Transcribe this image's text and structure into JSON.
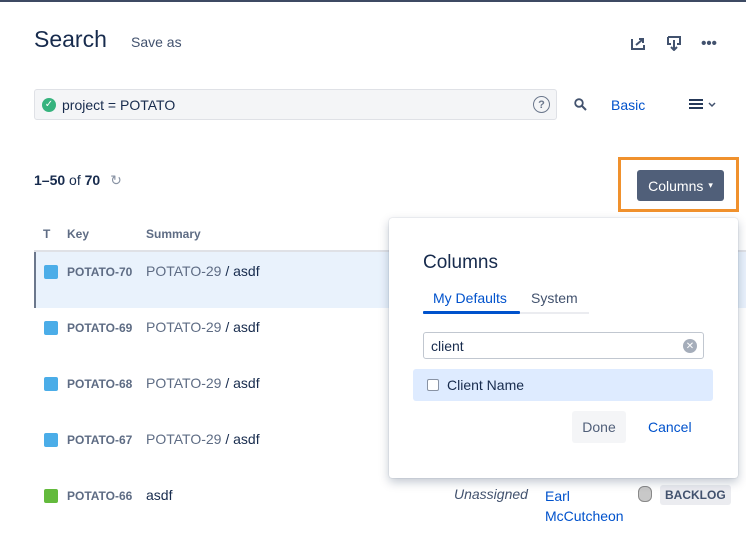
{
  "header": {
    "title": "Search",
    "save_as": "Save as"
  },
  "toolbar_icons": [
    "share-icon",
    "export-icon",
    "more-icon"
  ],
  "jql": {
    "query": "project = POTATO",
    "help": "?",
    "basic_label": "Basic"
  },
  "results": {
    "range": "1–50",
    "of": "of",
    "total": "70"
  },
  "columns_button": "Columns",
  "table": {
    "headers": [
      "T",
      "Key",
      "Summary"
    ],
    "rows": [
      {
        "type": "subtask",
        "key": "POTATO-70",
        "parent": "POTATO-29",
        "summary": "asdf"
      },
      {
        "type": "subtask",
        "key": "POTATO-69",
        "parent": "POTATO-29",
        "summary": "asdf"
      },
      {
        "type": "subtask",
        "key": "POTATO-68",
        "parent": "POTATO-29",
        "summary": "asdf"
      },
      {
        "type": "subtask",
        "key": "POTATO-67",
        "parent": "POTATO-29",
        "summary": "asdf"
      },
      {
        "type": "story",
        "key": "POTATO-66",
        "parent": "",
        "summary": "asdf",
        "assignee": "Unassigned",
        "reporter_line1": "Earl",
        "reporter_line2": "McCutcheon",
        "status": "BACKLOG"
      }
    ]
  },
  "popup": {
    "title": "Columns",
    "tabs": [
      "My Defaults",
      "System"
    ],
    "search_value": "client",
    "options": [
      {
        "label": "Client Name",
        "checked": false
      }
    ],
    "done": "Done",
    "cancel": "Cancel"
  },
  "colors": {
    "accent": "#0052cc",
    "highlight": "#f0912d",
    "button": "#505f79"
  }
}
